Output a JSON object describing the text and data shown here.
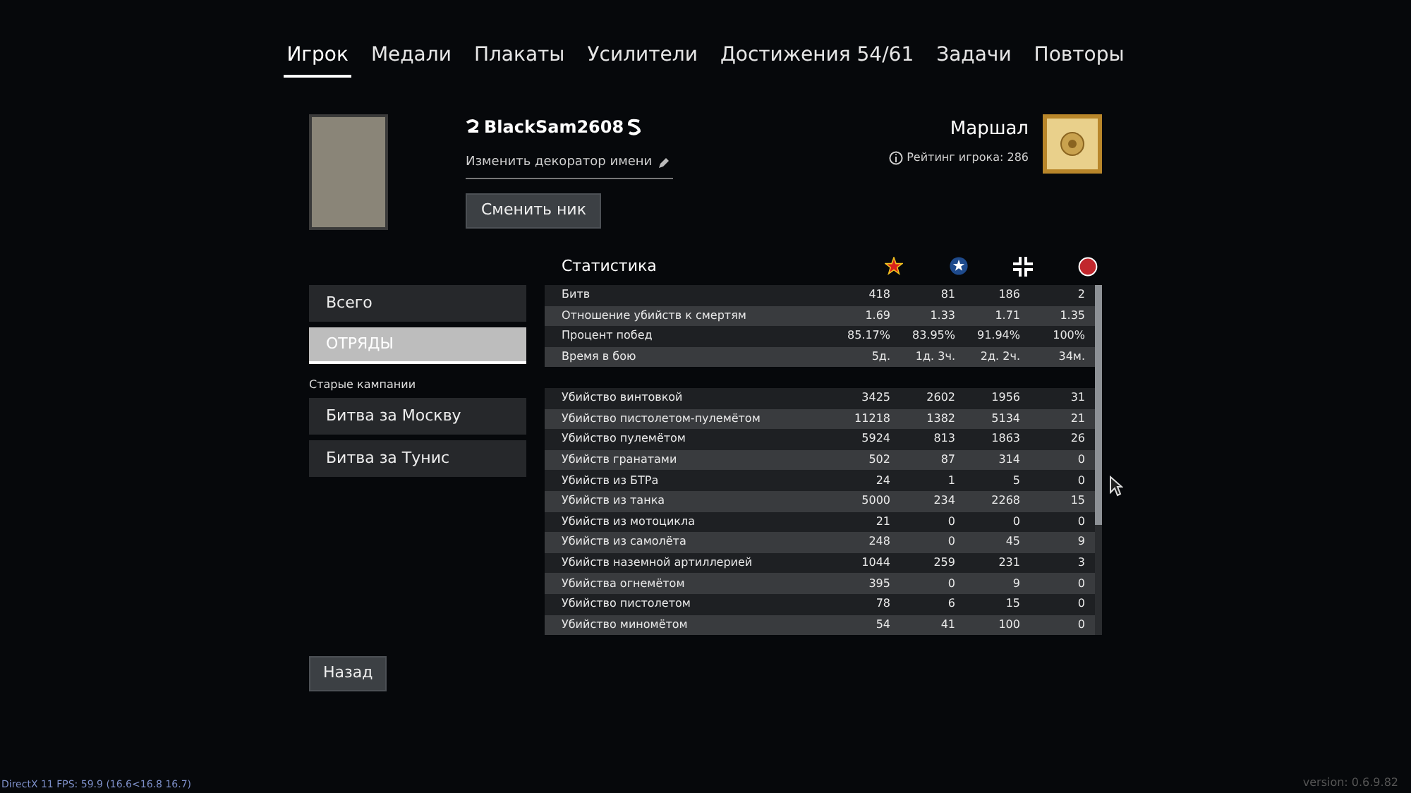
{
  "tabs": [
    {
      "label": "Игрок",
      "selected": true
    },
    {
      "label": "Медали",
      "selected": false
    },
    {
      "label": "Плакаты",
      "selected": false
    },
    {
      "label": "Усилители",
      "selected": false
    },
    {
      "label": "Достижения 54/61",
      "selected": false
    },
    {
      "label": "Задачи",
      "selected": false
    },
    {
      "label": "Повторы",
      "selected": false
    }
  ],
  "profile": {
    "nickname": "BlackSam2608",
    "decorator_link": "Изменить декоратор имени",
    "change_nick_button": "Сменить ник",
    "rank": "Маршал",
    "rating": "Рейтинг игрока: 286"
  },
  "sidebar": {
    "items": [
      {
        "label": "Всего",
        "selected": false
      },
      {
        "label": "ОТРЯДЫ",
        "selected": true
      }
    ],
    "section_label": "Старые кампании",
    "campaigns": [
      {
        "label": "Битва за Москву",
        "selected": false
      },
      {
        "label": "Битва за Тунис",
        "selected": false
      }
    ]
  },
  "stats": {
    "title": "Статистика",
    "columns": [
      {
        "kind": "red-star"
      },
      {
        "kind": "blue-star"
      },
      {
        "kind": "cross"
      },
      {
        "kind": "circle"
      }
    ],
    "groups": [
      [
        {
          "label": "Битв",
          "values": [
            "418",
            "81",
            "186",
            "2"
          ]
        },
        {
          "label": "Отношение убийств к смертям",
          "values": [
            "1.69",
            "1.33",
            "1.71",
            "1.35"
          ]
        },
        {
          "label": "Процент побед",
          "values": [
            "85.17%",
            "83.95%",
            "91.94%",
            "100%"
          ]
        },
        {
          "label": "Время в бою",
          "values": [
            "5д.",
            "1д. 3ч.",
            "2д. 2ч.",
            "34м."
          ]
        }
      ],
      [
        {
          "label": "Убийство винтовкой",
          "values": [
            "3425",
            "2602",
            "1956",
            "31"
          ]
        },
        {
          "label": "Убийство пистолетом-пулемётом",
          "values": [
            "11218",
            "1382",
            "5134",
            "21"
          ]
        },
        {
          "label": "Убийство пулемётом",
          "values": [
            "5924",
            "813",
            "1863",
            "26"
          ]
        },
        {
          "label": "Убийств гранатами",
          "values": [
            "502",
            "87",
            "314",
            "0"
          ]
        },
        {
          "label": "Убийств из БТРа",
          "values": [
            "24",
            "1",
            "5",
            "0"
          ]
        },
        {
          "label": "Убийств из танка",
          "values": [
            "5000",
            "234",
            "2268",
            "15"
          ]
        },
        {
          "label": "Убийств из мотоцикла",
          "values": [
            "21",
            "0",
            "0",
            "0"
          ]
        },
        {
          "label": "Убийств из самолёта",
          "values": [
            "248",
            "0",
            "45",
            "9"
          ]
        },
        {
          "label": "Убийств наземной артиллерией",
          "values": [
            "1044",
            "259",
            "231",
            "3"
          ]
        },
        {
          "label": "Убийства огнемётом",
          "values": [
            "395",
            "0",
            "9",
            "0"
          ]
        },
        {
          "label": "Убийство пистолетом",
          "values": [
            "78",
            "6",
            "15",
            "0"
          ]
        },
        {
          "label": "Убийство миномётом",
          "values": [
            "54",
            "41",
            "100",
            "0"
          ]
        }
      ]
    ]
  },
  "back_button": "Назад",
  "footer": {
    "fps": "DirectX 11 FPS: 59.9 (16.6<16.8 16.7)",
    "version": "version: 0.6.9.82"
  }
}
